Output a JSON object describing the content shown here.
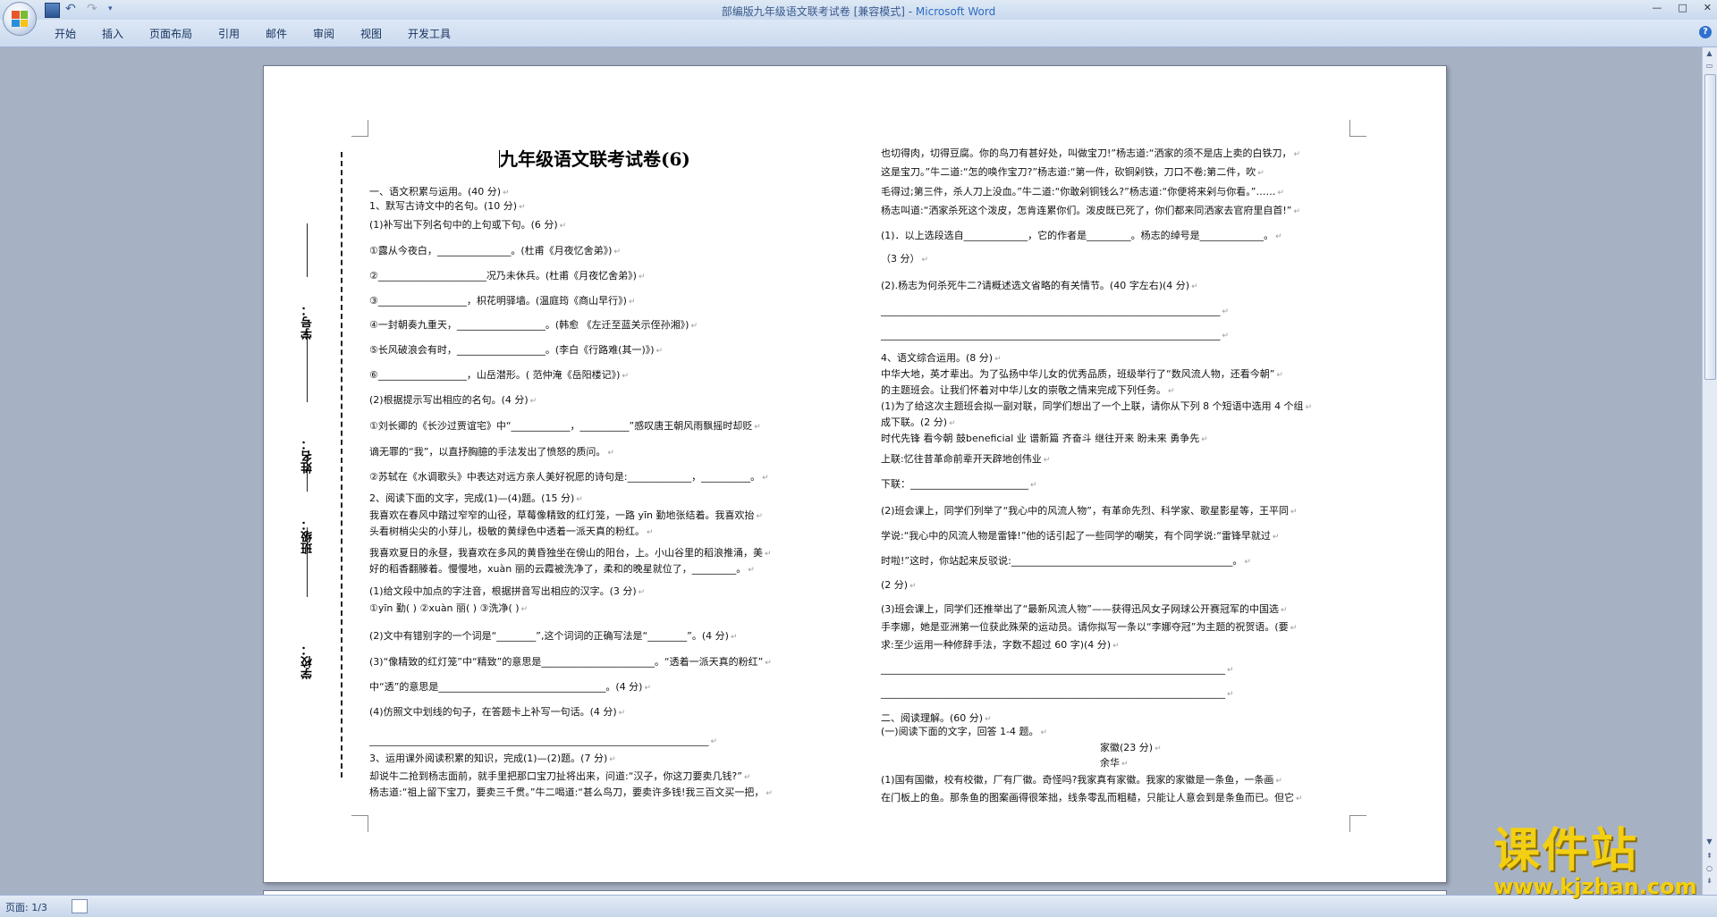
{
  "window": {
    "title": "部编版九年级语文联考试卷 [兼容模式] - ",
    "app_name": "Microsoft Word",
    "controls": [
      "—",
      "□",
      "✕"
    ]
  },
  "qat": {
    "icons": [
      "save-icon",
      "undo-icon",
      "redo-icon",
      "customize-icon"
    ]
  },
  "ribbon": {
    "tabs": [
      "开始",
      "插入",
      "页面布局",
      "引用",
      "邮件",
      "审阅",
      "视图",
      "开发工具"
    ]
  },
  "status": {
    "page": "页面: 1/3"
  },
  "doc": {
    "title": "九年级语文联考试卷(6)",
    "binding": {
      "school": "学校：",
      "class": "班级：",
      "name": "姓名：",
      "number": "学号："
    },
    "left_lines": [
      "一、语文积累与运用。(40 分)",
      "1、默写古诗文中的名句。(10 分)",
      "(1)补写出下列名句中的上句或下句。(6 分)",
      "  ①露从今夜白，_______________。(杜甫《月夜忆舍弟》)",
      "②______________________况乃未休兵。(杜甫《月夜忆舍弟》)",
      "③__________________，枳花明驿墙。(温庭筠《商山早行》)",
      "④一封朝奏九重天，__________________。(韩愈 《左迁至蓝关示侄孙湘》)",
      "⑤长风破浪会有时，__________________。(李白《行路难(其一)》)",
      "⑥__________________，山岳潜形。( 范仲淹《岳阳楼记》)",
      "(2)根据提示写出相应的名句。(4 分)",
      "①刘长卿的《长沙过贾谊宅》中“____________，__________”感叹唐王朝风雨飘摇时却贬",
      "谪无罪的“我”，以直抒胸臆的手法发出了愤怒的质问。",
      "②苏轼在《水调歌头》中表达对远方亲人美好祝愿的诗句是:_____________，__________。",
      "2、阅读下面的文字，完成(1)—(4)题。(15 分)",
      "      我喜欢在春风中踏过窄窄的山径，草莓像精致的红灯笼，一路 yīn 勤地张结着。我喜欢抬",
      "头看树梢尖尖的小芽儿，极敏的黄绿色中透着一派天真的粉红。",
      "      我喜欢夏日的永昼，我喜欢在多风的黄昏独坐在傍山的阳台，上。小山谷里的稻浪推涌，美",
      "好的稻香翻滕着。慢慢地，xuàn 丽的云霞被洗净了，柔和的晚星就位了，_________。",
      "(1)给文段中加点的字注音，根据拼音写出相应的汉字。(3 分)",
      "   ①yīn 勤(        )       ②xuàn 丽(          )       ③洗净(          )",
      "(2)文中有错别字的一个词是“________”,这个词词的正确写法是“________”。(4 分)",
      "(3)“像精致的红灯笼”中“精致”的意思是_______________________。“透着一派天真的粉红”",
      "中“透”的意思是__________________________________。(4 分)",
      "(4)仿照文中划线的句子，在答题卡上补写一句话。(4 分)",
      "    _____________________________________________________________________",
      "3、运用课外阅读积累的知识，完成(1)—(2)题。(7 分)",
      "      却说牛二抢到杨志面前，就手里把那口宝刀扯将出来，问道:“汉子，你这刀要卖几钱?”",
      "杨志道:“祖上留下宝刀，要卖三千贯。”牛二喝道:“甚么鸟刀，要卖许多钱!我三百文买一把，"
    ],
    "right_lines": [
      "也切得肉，切得豆腐。你的鸟刀有甚好处，叫做宝刀!”杨志道:“洒家的须不是店上卖的白铁刀，",
      "这是宝刀。”牛二道:“怎的唤作宝刀?”杨志道:“第一件，砍铜剁铁，刀口不卷;第二件，吹",
      "毛得过;第三件，杀人刀上没血。”牛二道:“你敢剁铜钱么?”杨志道:“你便将来剁与你看。”……",
      "杨志叫道:“洒家杀死这个泼皮，怎肯连累你们。泼皮既已死了，你们都来同洒家去官府里自首!”",
      "(1)．以上选段选自_____________，它的作者是_________。杨志的绰号是_____________。",
      "（3 分）",
      "(2).杨志为何杀死牛二?请概述选文省略的有关情节。(40 字左右)(4 分)",
      "_____________________________________________________________________",
      "_____________________________________________________________________",
      "4、语文综合运用。(8 分)",
      "      中华大地，英才辈出。为了弘扬中华儿女的优秀品质，班级举行了“数风流人物，还看今朝”",
      "   的主题班会。让我们怀着对中华儿女的崇敬之情来完成下列任务。",
      "(1)为了给这次主题班会拟一副对联，同学们想出了一个上联，请你从下列 8 个短语中选用 4 个组",
      "成下联。(2 分)",
      "   时代先锋    看今朝    鼓beneficial 业    谱新篇    齐奋斗    继往开来    盼未来    勇争先",
      "  上联:忆往昔革命前辈开天辟地创伟业",
      "   下联：________________________",
      "(2)班会课上，同学们列举了“我心中的风流人物”，有革命先烈、科学家、歌星影星等，王平同",
      "   学说:“我心中的风流人物是雷锋!”他的话引起了一些同学的嘲笑，有个同学说:“雷锋早就过",
      "   时啦!”这时，你站起来反驳说:_____________________________________________。",
      "   (2 分)",
      "  (3)班会课上，同学们还推举出了“最新风流人物”——获得迅风女子网球公开赛冠军的中国选",
      "手李娜，她是亚洲第一位获此殊荣的运动员。请你拟写一条以“李娜夺冠”为主题的祝贺语。(要",
      "求:至少运用一种修辞手法，字数不超过 60 字)(4 分)",
      "  ______________________________________________________________________",
      "  ______________________________________________________________________",
      "二、阅读理解。(60 分)",
      "   (一)阅读下面的文字，回答 1-4 题。",
      "家徽(23 分)",
      "余华",
      "      (1)国有国徽，校有校徽，厂有厂徽。奇怪吗?我家真有家徽。我家的家徽是一条鱼，一条画",
      "在门板上的鱼。那条鱼的图案画得很笨拙，线条零乱而粗糙，只能让人意会到是条鱼而已。但它"
    ]
  },
  "watermark": {
    "line1": "课件站",
    "line2": "www.kjzhan.com"
  },
  "colors": {
    "accent": "#2d6bc2",
    "watermark": "#f3cf12",
    "frame": "#a6b1c3"
  }
}
